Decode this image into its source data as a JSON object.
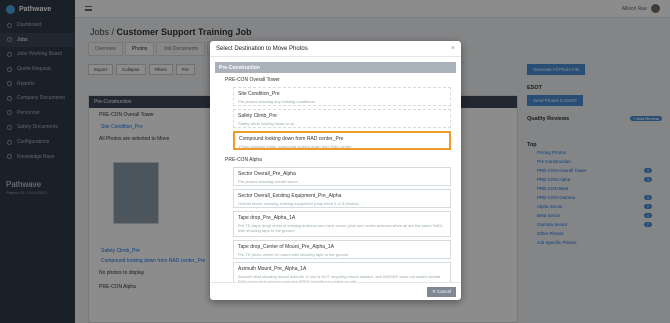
{
  "app": {
    "name": "Pathwave"
  },
  "sidebar": {
    "items": [
      {
        "label": "Dashboard",
        "icon": "dashboard-icon"
      },
      {
        "label": "Jobs",
        "icon": "jobs-icon",
        "active": true
      },
      {
        "label": "Jobs Working Board",
        "icon": "board-icon"
      },
      {
        "label": "Quote Request",
        "icon": "quote-icon"
      },
      {
        "label": "Reports",
        "icon": "reports-icon"
      },
      {
        "label": "Company Documents",
        "icon": "documents-icon"
      },
      {
        "label": "Personnel",
        "icon": "personnel-icon"
      },
      {
        "label": "Safety Documents",
        "icon": "safety-icon"
      },
      {
        "label": "Configurations",
        "icon": "config-icon"
      },
      {
        "label": "Knowledge Base",
        "icon": "knowledge-icon"
      }
    ],
    "brand_name": "Pathwave",
    "brand_sub": "Partner ID: 12/10/2023"
  },
  "topbar": {
    "user_name": "Allison Rae"
  },
  "page": {
    "breadcrumb_root": "Jobs",
    "breadcrumb_sep": " / ",
    "title": "Customer Support Training Job",
    "tabs": [
      "Overview",
      "Photos",
      "Job Documents",
      "Safety D..."
    ],
    "toolbar": [
      "Export",
      "Collapse",
      "Filters",
      "Pre"
    ]
  },
  "background": {
    "section_header": "Pre-Construction",
    "group": "PRE-CON Overall Tower",
    "item1": "Site Condition_Pre",
    "all_photos": "All Photos are selected to Move",
    "item2": "Safety Climb_Pre",
    "item3": "Compound looking down from RAD center_Pre",
    "no_photos": "No photos to display",
    "group2": "PRE-CON Alpha",
    "move_label": "Cancel Move"
  },
  "right_panel": {
    "generate_button": "Generate All Photo File",
    "esot_title": "ESOT",
    "send_button": "Send Photos to ESOT",
    "quality_title": "Quality Reviews",
    "add_review": "+ Add Review",
    "tree_title": "Top",
    "tree": [
      {
        "label": "Pricing Photos",
        "count": ""
      },
      {
        "label": "Pre-Construction",
        "count": ""
      },
      {
        "label": "PRE-CON Overall Tower",
        "count": "3"
      },
      {
        "label": "PRE-CON Alpha",
        "count": "3"
      },
      {
        "label": "PRE-CON Beta",
        "count": ""
      },
      {
        "label": "PRE-CON Gamma",
        "count": "3"
      },
      {
        "label": "Alpha Sector",
        "count": "7"
      },
      {
        "label": "Beta Sector",
        "count": "4"
      },
      {
        "label": "Gamma Sector",
        "count": "7"
      },
      {
        "label": "Other Photos",
        "count": ""
      },
      {
        "label": "Job Specific Photos",
        "count": ""
      }
    ]
  },
  "modal": {
    "title": "Select Destination to Move Photos",
    "section": "Pre-Construction",
    "groups": [
      {
        "label": "PRE-CON Overall Tower",
        "items": [
          {
            "title": "Site Condition_Pre",
            "desc": "Pre photos showing any existing conditions.",
            "style": "dashed"
          },
          {
            "title": "Safety Climb_Pre",
            "desc": "Safety climb looking down or up",
            "style": "dashed"
          },
          {
            "title": "Compound looking down from RAD center_Pre",
            "desc": "Photo showing entire compound looking down from RAD center",
            "style": "selected"
          }
        ]
      },
      {
        "label": "PRE-CON Alpha",
        "items": [
          {
            "title": "Sector Overall_Pre_Alpha",
            "desc": "Pre photos showing overall sector",
            "style": "normal"
          },
          {
            "title": "Sector Overall_Existing Equipment_Pre_Alpha",
            "desc": "Overall sector showing existing equipment (may need 2 or 3 photos)",
            "style": "normal"
          },
          {
            "title": "Tape drop_Pre_Alpha_1A",
            "desc": "Pre TD (tape drop) shots of existing antenna one each sector (pick one center antenna when all are the same RAD) with showing tape to the ground",
            "style": "tall"
          },
          {
            "title": "Tape drop_Center of Mount_Pre_Alpha_1A",
            "desc": "Pre TD photo center of mount with showing tape to the ground",
            "style": "normal"
          },
          {
            "title": "Azimuth Mount_Pre_Alpha_1A",
            "desc": "Azimuth field showing mount azimuth. If one is NOT requiring mount rotation, and MISSED does not match central RAN approval is need to have the RFDS identified to match on site",
            "style": "tall"
          }
        ]
      }
    ],
    "cancel_label": "Cancel"
  },
  "colors": {
    "accent": "#f09a2a",
    "sidebar_bg": "#2f3b4a",
    "primary_button": "#4a8fd8"
  }
}
